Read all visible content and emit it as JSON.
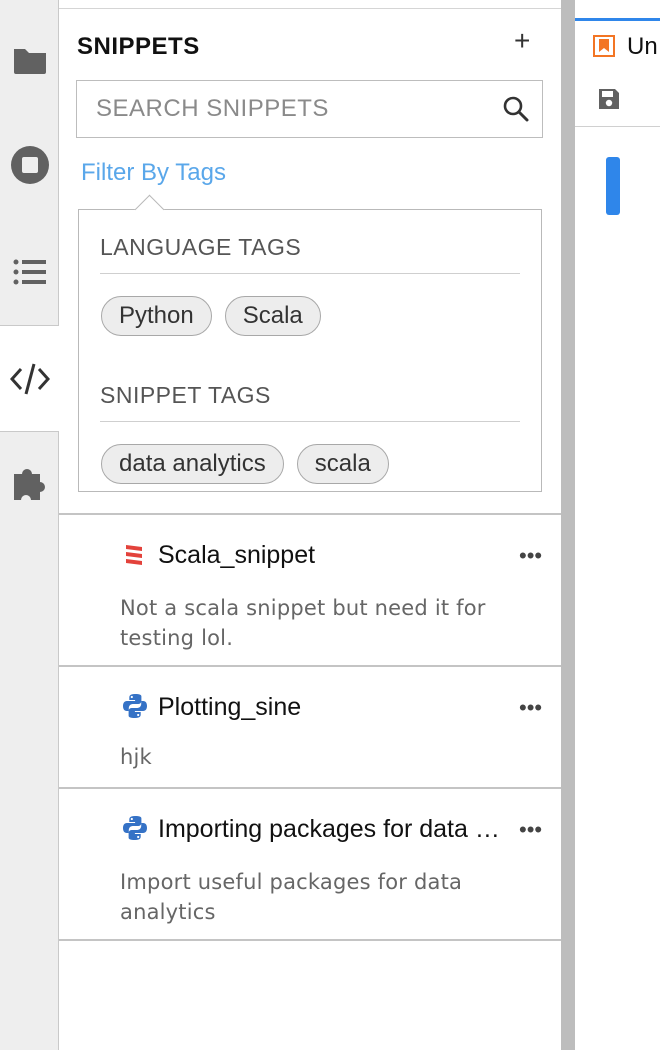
{
  "sidebar_panel": {
    "title": "SNIPPETS",
    "add_label": "+",
    "search": {
      "placeholder": "SEARCH SNIPPETS",
      "value": ""
    },
    "filter_link": "Filter By Tags",
    "tag_filter": {
      "language_title": "LANGUAGE TAGS",
      "language_tags": [
        "Python",
        "Scala"
      ],
      "snippet_title": "SNIPPET TAGS",
      "snippet_tags": [
        "data analytics",
        "scala"
      ]
    },
    "snippets": [
      {
        "name": "Scala_snippet",
        "language": "scala",
        "icon": "scala-icon",
        "description": "Not a scala snippet but need it for testing lol.",
        "more": "•••"
      },
      {
        "name": "Plotting_sine",
        "language": "python",
        "icon": "python-icon",
        "description": "hjk",
        "more": "•••"
      },
      {
        "name": "Importing packages for data analytics",
        "language": "python",
        "icon": "python-icon",
        "description": "Import useful packages for data analytics",
        "more": "•••"
      }
    ]
  },
  "activity_bar": {
    "items": [
      "folder-icon",
      "stop-circle-icon",
      "list-icon",
      "code-icon",
      "puzzle-icon"
    ],
    "active": "code-icon"
  },
  "main": {
    "tab_label": "Un",
    "tab_icon": "notebook-icon",
    "toolbar_icon": "save-icon"
  },
  "colors": {
    "accent": "#2f86ea",
    "filter_link": "#5aa7ea",
    "scala_red": "#e3423b",
    "python_blue": "#3572c6",
    "notebook_orange": "#f37524"
  }
}
